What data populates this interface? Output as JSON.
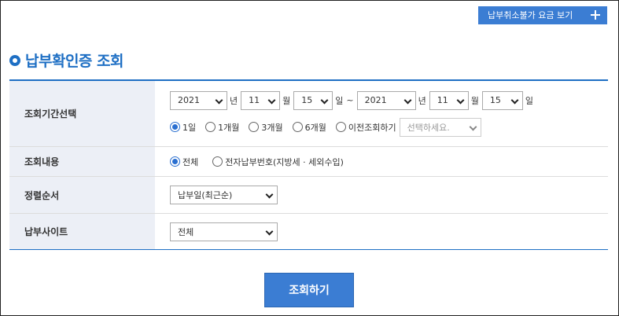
{
  "top_button": {
    "label": "납부취소불가 요금 보기"
  },
  "page": {
    "title": "납부확인증 조회"
  },
  "period": {
    "label": "조회기간선택",
    "from": {
      "year": "2021",
      "month": "11",
      "day": "15"
    },
    "to": {
      "year": "2021",
      "month": "11",
      "day": "15"
    },
    "units": {
      "year": "년",
      "month": "월",
      "day": "일",
      "tilde": "~"
    },
    "quick_options": [
      {
        "label": "1일",
        "checked": true
      },
      {
        "label": "1개월",
        "checked": false
      },
      {
        "label": "3개월",
        "checked": false
      },
      {
        "label": "6개월",
        "checked": false
      },
      {
        "label": "이전조회하기",
        "checked": false
      }
    ],
    "previous_select_placeholder": "선택하세요."
  },
  "content": {
    "label": "조회내용",
    "options": [
      {
        "label": "전체",
        "checked": true
      },
      {
        "label": "전자납부번호(지방세 · 세외수입)",
        "checked": false
      }
    ]
  },
  "sort": {
    "label": "정렬순서",
    "selected": "납부일(최근순)"
  },
  "site": {
    "label": "납부사이트",
    "selected": "전체"
  },
  "submit": {
    "label": "조회하기"
  },
  "colors": {
    "accent": "#1e6fc4",
    "button": "#3b7dd3",
    "header_bg": "#eceff6"
  }
}
